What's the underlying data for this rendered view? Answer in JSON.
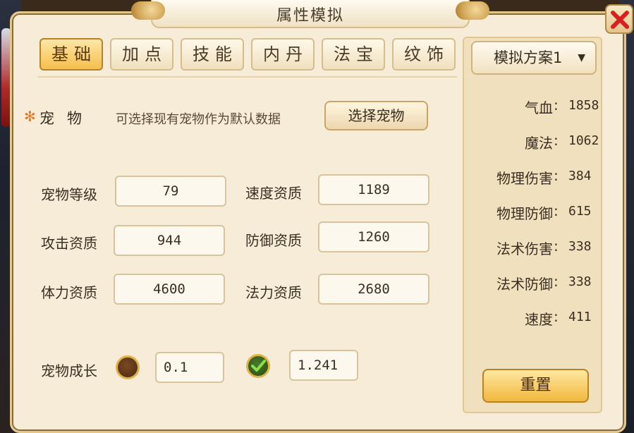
{
  "window": {
    "title": "属性模拟"
  },
  "tabs": [
    {
      "label": "基础",
      "active": true
    },
    {
      "label": "加点",
      "active": false
    },
    {
      "label": "技能",
      "active": false
    },
    {
      "label": "内丹",
      "active": false
    },
    {
      "label": "法宝",
      "active": false
    },
    {
      "label": "纹饰",
      "active": false
    }
  ],
  "pet": {
    "required_mark": "✻",
    "label": "宠物",
    "hint": "可选择现有宠物作为默认数据",
    "choose_button": "选择宠物"
  },
  "fields": {
    "pet_level": {
      "label": "宠物等级",
      "value": "79"
    },
    "speed_aptitude": {
      "label": "速度资质",
      "value": "1189"
    },
    "attack_aptitude": {
      "label": "攻击资质",
      "value": "944"
    },
    "defense_aptitude": {
      "label": "防御资质",
      "value": "1260"
    },
    "hp_aptitude": {
      "label": "体力资质",
      "value": "4600"
    },
    "mana_aptitude": {
      "label": "法力资质",
      "value": "2680"
    }
  },
  "growth": {
    "label": "宠物成长",
    "option1": {
      "value": "0.1",
      "selected": false
    },
    "option2": {
      "value": "1.241",
      "selected": true
    }
  },
  "sidebar": {
    "scheme_label": "模拟方案1",
    "stats": [
      {
        "name": "气血",
        "value": "1858"
      },
      {
        "name": "魔法",
        "value": "1062"
      },
      {
        "name": "物理伤害",
        "value": "384"
      },
      {
        "name": "物理防御",
        "value": "615"
      },
      {
        "name": "法术伤害",
        "value": "338"
      },
      {
        "name": "法术防御",
        "value": "338"
      },
      {
        "name": "速度",
        "value": "411"
      }
    ],
    "reset_button": "重置"
  },
  "colors": {
    "accent": "#f5bf4c",
    "panel": "#f6ecd7",
    "close": "#d82020"
  }
}
